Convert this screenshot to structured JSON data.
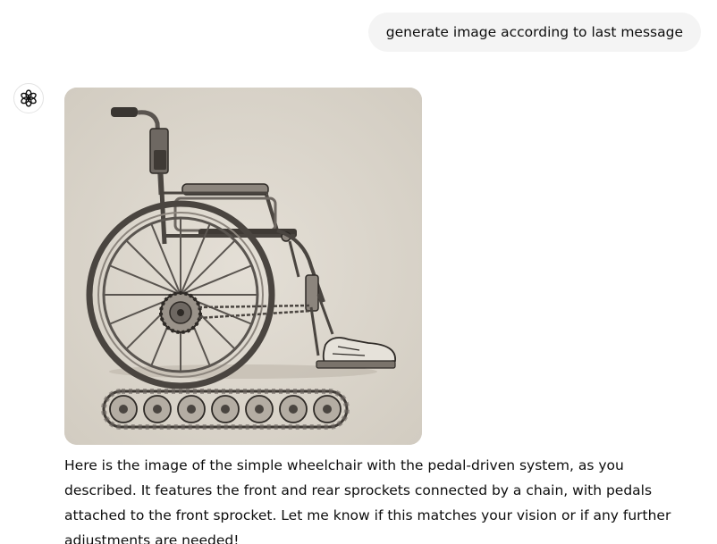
{
  "user_message": {
    "text": "generate image according to last message"
  },
  "assistant": {
    "avatar_icon": "openai-logo-icon",
    "image_subject": "pencil-sketch wheelchair with pedal-driven sprocket system",
    "response": "Here is the image of the simple wheelchair with the pedal-driven system, as you described. It features the front and rear sprockets connected by a chain, with pedals attached to the front sprocket. Let me know if this matches your vision or if any further adjustments are needed!"
  },
  "colors": {
    "user_bubble_bg": "#f4f4f4",
    "image_bg": "#d9d4ca",
    "text": "#0d0d0d"
  }
}
